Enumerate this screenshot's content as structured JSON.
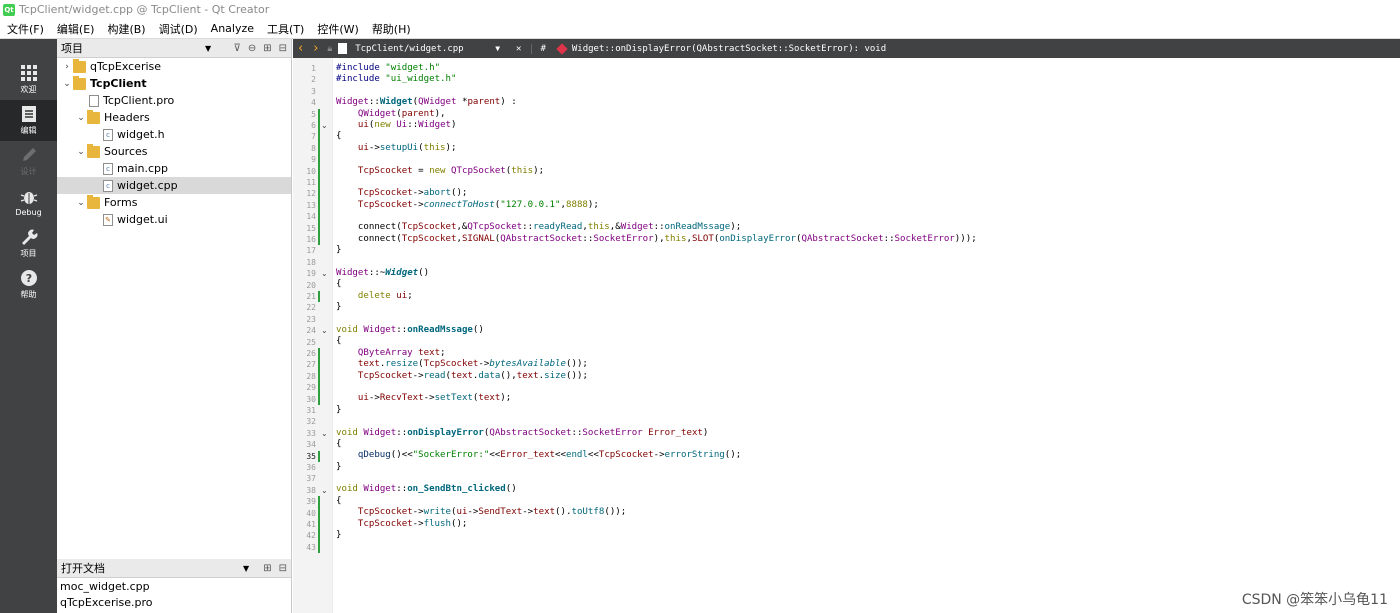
{
  "window_title": "TcpClient/widget.cpp @ TcpClient - Qt Creator",
  "menu": [
    "文件(F)",
    "编辑(E)",
    "构建(B)",
    "调试(D)",
    "Analyze",
    "工具(T)",
    "控件(W)",
    "帮助(H)"
  ],
  "modes": [
    {
      "label": "欢迎",
      "icon": "grid-icon"
    },
    {
      "label": "编辑",
      "icon": "edit-icon"
    },
    {
      "label": "设计",
      "icon": "pen-icon"
    },
    {
      "label": "Debug",
      "icon": "bug-icon"
    },
    {
      "label": "项目",
      "icon": "wrench-icon"
    },
    {
      "label": "帮助",
      "icon": "help-icon"
    }
  ],
  "projects": {
    "header": "项目",
    "tree": [
      {
        "label": "qTcpExcerise",
        "type": "folder",
        "arrow": "›"
      },
      {
        "label": "TcpClient",
        "type": "folder",
        "arrow": "⌄",
        "bold": true
      },
      {
        "label": "TcpClient.pro",
        "type": "pro"
      },
      {
        "label": "Headers",
        "type": "folder",
        "arrow": "⌄"
      },
      {
        "label": "widget.h",
        "type": "h"
      },
      {
        "label": "Sources",
        "type": "folder",
        "arrow": "⌄"
      },
      {
        "label": "main.cpp",
        "type": "cpp"
      },
      {
        "label": "widget.cpp",
        "type": "cpp",
        "selected": true
      },
      {
        "label": "Forms",
        "type": "folder",
        "arrow": "⌄"
      },
      {
        "label": "widget.ui",
        "type": "ui"
      }
    ]
  },
  "open_docs": {
    "header": "打开文档",
    "items": [
      "moc_widget.cpp",
      "qTcpExcerise.pro"
    ]
  },
  "editor": {
    "file": "TcpClient/widget.cpp",
    "hash": "#",
    "symbol": "Widget::onDisplayError(QAbstractSocket::SocketError): void",
    "current_line": 35,
    "line_count": 43
  },
  "code_lines": [
    "#include \"widget.h\"",
    "#include \"ui_widget.h\"",
    "",
    "Widget::Widget(QWidget *parent) :",
    "    QWidget(parent),",
    "    ui(new Ui::Widget)",
    "{",
    "    ui->setupUi(this);",
    "",
    "    TcpScocket = new QTcpSocket(this);",
    "",
    "    TcpScocket->abort();",
    "    TcpScocket->connectToHost(\"127.0.0.1\",8888);",
    "",
    "    connect(TcpScocket,&QTcpSocket::readyRead,this,&Widget::onReadMssage);",
    "    connect(TcpScocket,SIGNAL(QAbstractSocket::SocketError),this,SLOT(onDisplayError(QAbstractSocket::SocketError)));",
    "}",
    "",
    "Widget::~Widget()",
    "{",
    "    delete ui;",
    "}",
    "",
    "void Widget::onReadMssage()",
    "{",
    "    QByteArray text;",
    "    text.resize(TcpScocket->bytesAvailable());",
    "    TcpScocket->read(text.data(),text.size());",
    "",
    "    ui->RecvText->setText(text);",
    "}",
    "",
    "void Widget::onDisplayError(QAbstractSocket::SocketError Error_text)",
    "{",
    "    qDebug()<<\"SockerError:\"<<Error_text<<endl<<TcpScocket->errorString();",
    "}",
    "",
    "void Widget::on_SendBtn_clicked()",
    "{",
    "    TcpScocket->write(ui->SendText->text().toUtf8());",
    "    TcpScocket->flush();",
    "}",
    ""
  ],
  "watermark": "CSDN @笨笨小乌龟11"
}
